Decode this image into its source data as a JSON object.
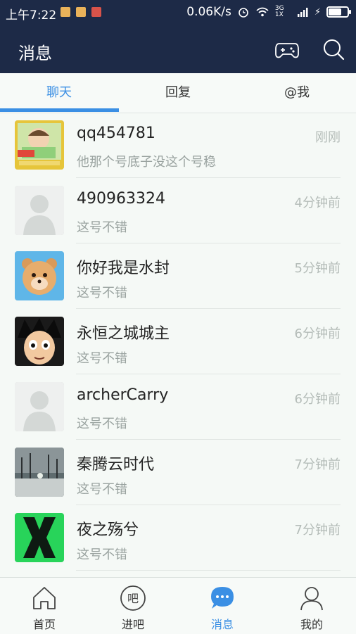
{
  "status_bar": {
    "time": "上午7:22",
    "speed": "0.06K/s",
    "network": "3G 1X",
    "battery_level": 0.8
  },
  "header": {
    "title": "消息",
    "game_icon": "gamepad-icon",
    "search_icon": "search-icon"
  },
  "tabs": [
    {
      "label": "聊天",
      "active": true
    },
    {
      "label": "回复",
      "active": false
    },
    {
      "label": "@我",
      "active": false
    }
  ],
  "messages": [
    {
      "name": "qq454781",
      "preview": "他那个号底子没这个号稳",
      "time": "刚刚",
      "avatar": "cartoon-avatar"
    },
    {
      "name": "490963324",
      "preview": "这号不错",
      "time": "4分钟前",
      "avatar": "default-avatar"
    },
    {
      "name": "你好我是水封",
      "preview": "这号不错",
      "time": "5分钟前",
      "avatar": "bear-avatar"
    },
    {
      "name": "永恒之城城主",
      "preview": "这号不错",
      "time": "6分钟前",
      "avatar": "anime-avatar"
    },
    {
      "name": "archerCarry",
      "preview": "这号不错",
      "time": "6分钟前",
      "avatar": "default-avatar"
    },
    {
      "name": "秦腾云时代",
      "preview": "这号不错",
      "time": "7分钟前",
      "avatar": "landscape-avatar"
    },
    {
      "name": "夜之殇兮",
      "preview": "这号不错",
      "time": "7分钟前",
      "avatar": "x-avatar"
    }
  ],
  "bottom_nav": [
    {
      "label": "首页",
      "icon": "home-icon",
      "active": false
    },
    {
      "label": "进吧",
      "icon": "ba-icon",
      "active": false
    },
    {
      "label": "消息",
      "icon": "message-icon",
      "active": true
    },
    {
      "label": "我的",
      "icon": "profile-icon",
      "active": false
    }
  ],
  "colors": {
    "header_bg": "#1d2a47",
    "accent": "#3b8fe4",
    "background": "#f5f9f6"
  }
}
